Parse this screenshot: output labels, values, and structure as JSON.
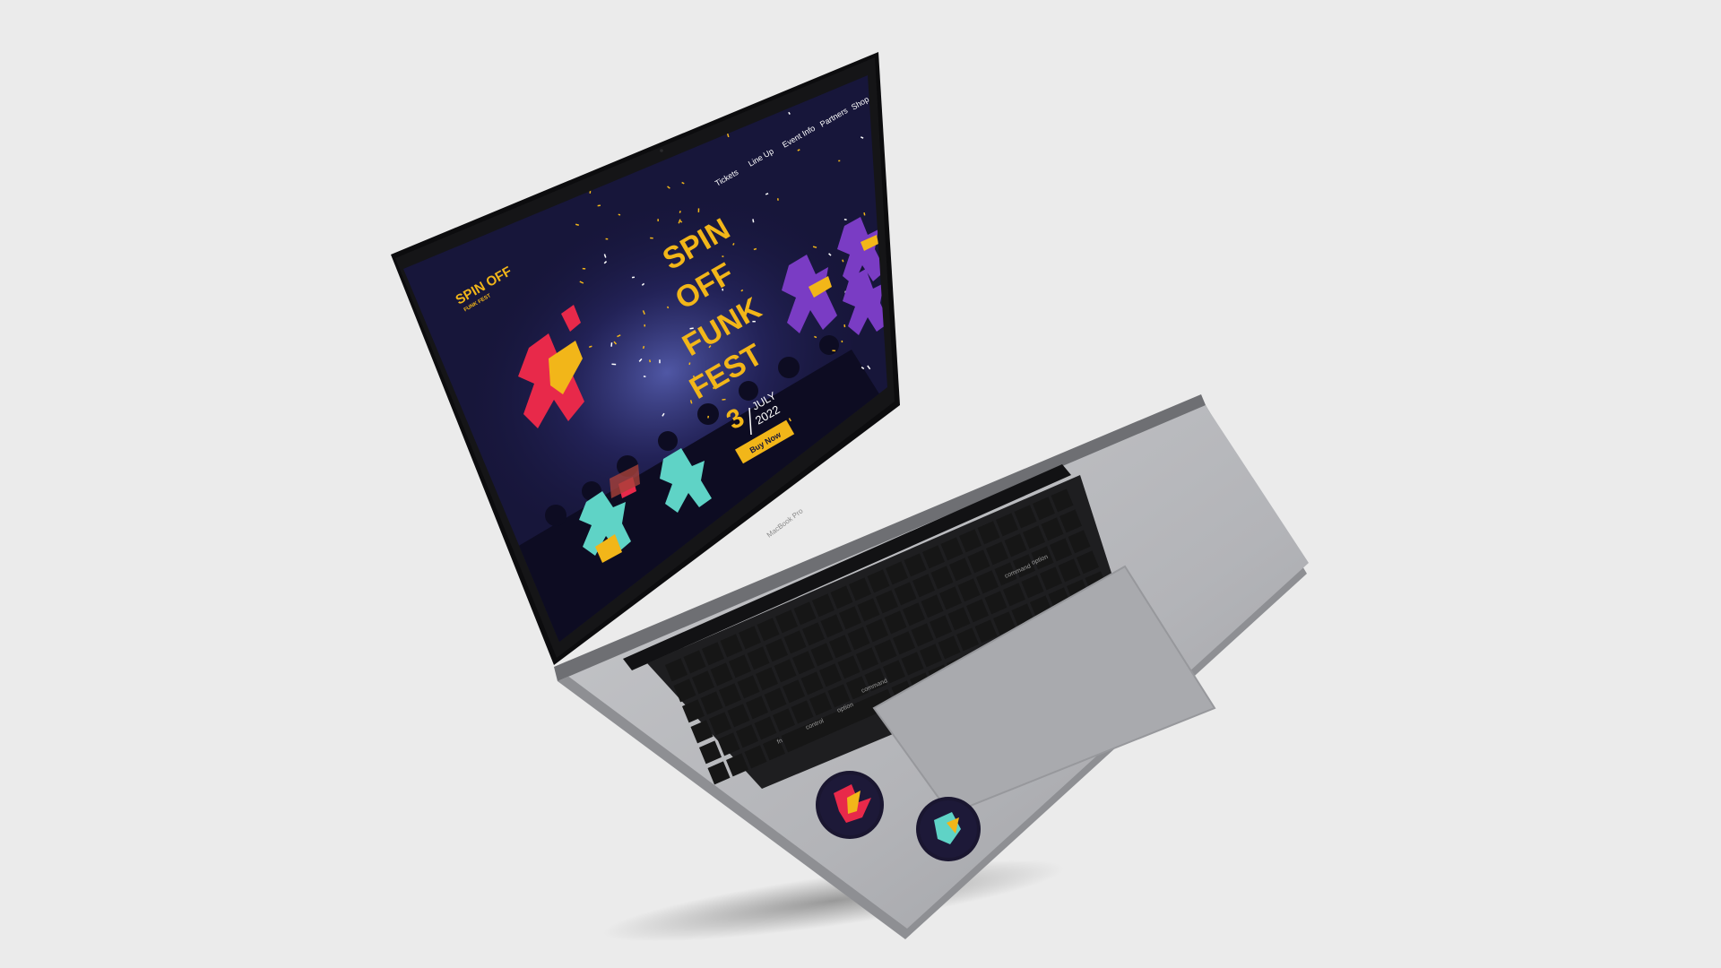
{
  "site": {
    "logo_text": "SPIN OFF",
    "logo_subtext": "FUNK FEST",
    "nav": [
      {
        "label": "Tickets"
      },
      {
        "label": "Line Up"
      },
      {
        "label": "Event Info"
      },
      {
        "label": "Partners"
      },
      {
        "label": "Shop"
      }
    ],
    "hero": {
      "title_lines": [
        "SPIN",
        "OFF",
        "FUNK",
        "FEST"
      ],
      "date_day": "3",
      "date_month": "JULY",
      "date_year": "2022",
      "cta_label": "Buy Now"
    }
  },
  "laptop": {
    "model_label": "MacBook Pro",
    "keys": {
      "command": "command",
      "option": "option",
      "control": "control",
      "fn": "fn"
    }
  },
  "colors": {
    "background": "#ebebeb",
    "screen_bg": "#17163a",
    "accent_yellow": "#f2b619",
    "accent_red": "#e8294a",
    "accent_purple": "#7a3cc4",
    "accent_teal": "#5fd3c6",
    "laptop_body": "#b8b9bd",
    "bezel": "#0c0c0e"
  },
  "stickers": [
    {
      "icon": "red-dancer-sticker-icon"
    },
    {
      "icon": "teal-dancer-sticker-icon"
    }
  ]
}
